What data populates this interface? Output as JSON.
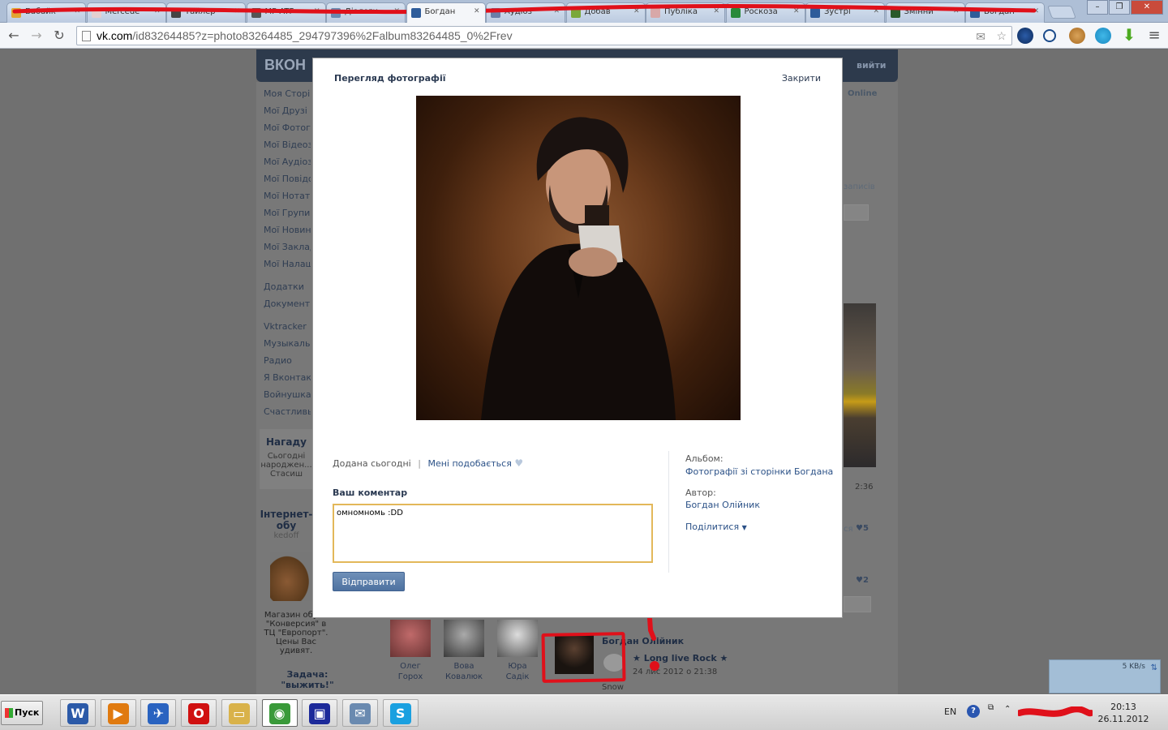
{
  "browser": {
    "tabs": [
      {
        "label": "Бабайк"
      },
      {
        "label": "Mercede"
      },
      {
        "label": "Тайлер"
      },
      {
        "label": "MP-ATF"
      },
      {
        "label": "Діалоги"
      },
      {
        "label": "Богдан",
        "active": true
      },
      {
        "label": "Аудіоз"
      },
      {
        "label": "Добав"
      },
      {
        "label": "Публіка"
      },
      {
        "label": "Роскоза"
      },
      {
        "label": "Зустрі"
      },
      {
        "label": "Змінни"
      },
      {
        "label": "Богдан"
      }
    ],
    "url_host": "vk.com",
    "url_rest": "/id83264485?z=photo83264485_294797396%2Falbum83264485_0%2Frev",
    "window_controls": [
      "–",
      "❐",
      "✕"
    ]
  },
  "vk": {
    "logo": "ВКОН",
    "exit": "вийти",
    "online": "Online",
    "menu": [
      "Моя Сторінка",
      "Мої Друзі",
      "Мої Фотографії",
      "Мої Відеозаписи",
      "Мої Аудіозаписи",
      "Мої Повідомлення",
      "Мої Нотатки",
      "Мої Групи",
      "Мої Новини",
      "Мої Закладки",
      "Мої Налаштування",
      "",
      "Додатки",
      "Документи",
      "",
      "Vktracker",
      "Музыкальный",
      "Радио",
      "Я Вконтакте",
      "Войнушка",
      "Счастливый"
    ],
    "remind_title": "Нагаду",
    "remind_text": "Сьогодні народжен... Стасиш",
    "ad_title": "Інтернет-обу",
    "ad_source": "kedoff",
    "ad_text": "Магазин обуви \"Конверсия\" в ТЦ \"Европорт\". Цены Вас удивят.",
    "task_title": "Задача: \"выжить!\"",
    "right_posts_label": "записів",
    "right_time": "2:36",
    "right_likes_1": "5",
    "right_likes_2": "2",
    "right_likes_prefix": "ся",
    "friends": [
      {
        "first": "Олег",
        "last": "Горох"
      },
      {
        "first": "Вова",
        "last": "Ковалюк"
      },
      {
        "first": "Юра",
        "last": "Садік"
      }
    ],
    "post": {
      "author": "Богдан Олійник",
      "title": "★ Long live Rock ★",
      "date": "24 лис 2012 о 21:38",
      "snow": "Snow"
    }
  },
  "modal": {
    "title": "Перегляд фотографії",
    "close": "Закрити",
    "added": "Додана сьогодні",
    "sep": "|",
    "like": "Мені подобається",
    "album_label": "Альбом:",
    "album": "Фотографії зі сторінки Богдана",
    "author_label": "Автор:",
    "author": "Богдан Олійник",
    "share": "Поділитися",
    "comment_label": "Ваш коментар",
    "comment_value": "омномномь :DD",
    "send": "Відправити"
  },
  "netmeter": {
    "speed": "5 KB/s"
  },
  "taskbar": {
    "start": "Пуск",
    "lang": "EN",
    "help": "?",
    "time": "20:13",
    "date": "26.11.2012",
    "apps": [
      {
        "name": "word",
        "glyph": "W",
        "color": "#2c5aa8"
      },
      {
        "name": "media-player",
        "glyph": "▶",
        "color": "#e07a10"
      },
      {
        "name": "thunderbird",
        "glyph": "✈",
        "color": "#2a63c0"
      },
      {
        "name": "opera",
        "glyph": "O",
        "color": "#d01010"
      },
      {
        "name": "explorer",
        "glyph": "▭",
        "color": "#d9b24a"
      },
      {
        "name": "chrome",
        "glyph": "◉",
        "color": "#3a9a3a"
      },
      {
        "name": "floppy",
        "glyph": "▣",
        "color": "#1d2a9a"
      },
      {
        "name": "notes",
        "glyph": "✉",
        "color": "#6a8ab0"
      },
      {
        "name": "skype",
        "glyph": "S",
        "color": "#1aa0e0"
      }
    ]
  },
  "colors": {
    "vk_blue": "#2b5187",
    "focus_border": "#e3b85a",
    "annotation_red": "#e0101a"
  }
}
